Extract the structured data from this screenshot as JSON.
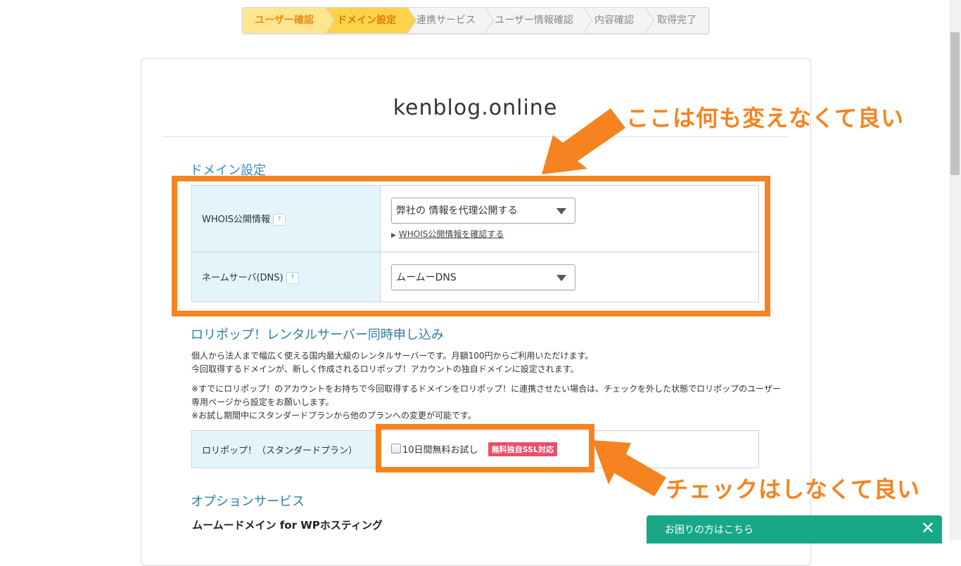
{
  "stepper": {
    "steps": [
      "ユーザー確認",
      "ドメイン設定",
      "連携サービス",
      "ユーザー情報確認",
      "内容確認",
      "取得完了"
    ]
  },
  "domain": {
    "name": "kenblog.online"
  },
  "domain_settings": {
    "heading": "ドメイン設定",
    "whois_label": "WHOIS公開情報",
    "whois_value": "弊社の 情報を代理公開する",
    "whois_link": "WHOIS公開情報を確認する",
    "ns_label": "ネームサーバ(DNS)",
    "ns_value": "ムームーDNS",
    "help_glyph": "?"
  },
  "lolipop": {
    "heading": "ロリポップ！レンタルサーバー同時申し込み",
    "desc_1": "個人から法人まで幅広く使える国内最大級のレンタルサーバーです。月額100円からご利用いただけます。",
    "desc_2": "今回取得するドメインが、新しく作成されるロリポップ！アカウントの独自ドメインに設定されます。",
    "note_1": "※すでにロリポップ！のアカウントをお持ちで今回取得するドメインをロリポップ！に連携させたい場合は、チェックを外した状態でロリポップのユーザー",
    "note_2": "専用ページから設定をお願いします。",
    "note_3": "※お試し期間中にスタンダードプランから他のプランへの変更が可能です。",
    "plan_label": "ロリポップ！（スタンダードプラン）",
    "trial_label": "10日間無料お試し",
    "ssl_badge": "無料独自SSL対応",
    "trial_checked": false
  },
  "options": {
    "heading": "オプションサービス",
    "sub_heading": "ムームードメイン for WPホスティング"
  },
  "annotations": {
    "top": "ここは何も変えなくて良い",
    "bottom": "チェックはしなくて良い",
    "color": "#f5831f"
  },
  "help_bar": {
    "label": "お困りの方はこちら",
    "close": "✕",
    "color": "#18a887"
  }
}
